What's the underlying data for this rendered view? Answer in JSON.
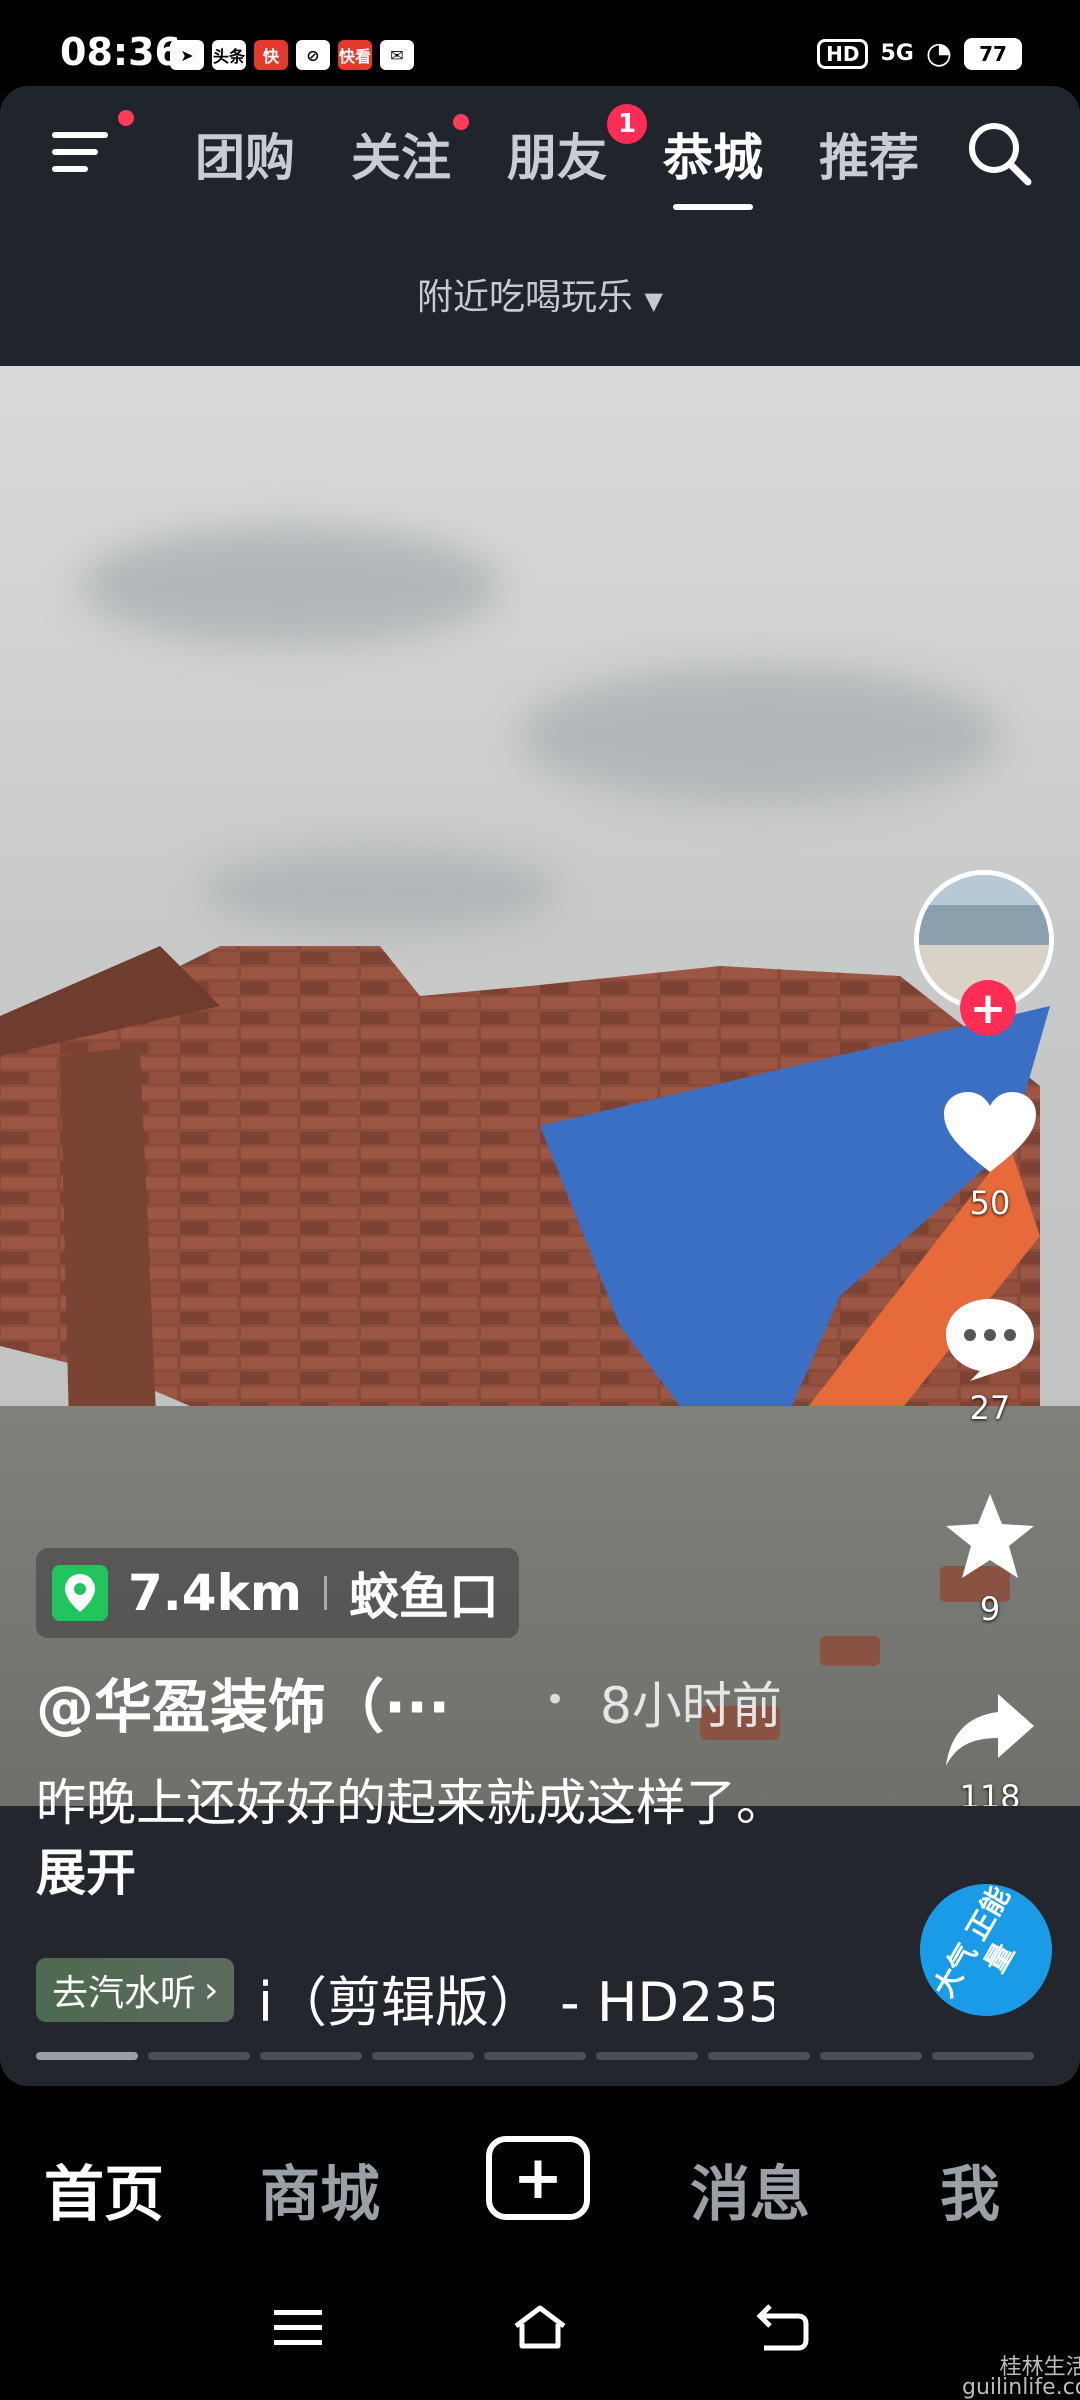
{
  "status": {
    "time": "08:36",
    "icons_left": [
      "头条",
      "快",
      "快看"
    ],
    "hd": "HD",
    "network": "5G",
    "battery": "77"
  },
  "tabs": [
    {
      "label": "团购",
      "dot": false
    },
    {
      "label": "关注",
      "dot": true
    },
    {
      "label": "朋友",
      "badge": "1"
    },
    {
      "label": "恭城",
      "active": true
    },
    {
      "label": "推荐"
    }
  ],
  "nearby_label": "附近吃喝玩乐",
  "location": {
    "distance": "7.4km",
    "place": "蛟鱼口"
  },
  "author": "@华盈装饰（···",
  "time_ago": "8小时前",
  "caption": {
    "text": "昨晚上还好好的起来就成这样了。",
    "expand": "展开"
  },
  "music": {
    "chip": "去汽水听",
    "title": "i（剪辑版） - HD235"
  },
  "energy_badge": "大气 正能量",
  "actions": {
    "likes": "50",
    "comments": "27",
    "favorites": "9",
    "shares": "118"
  },
  "nav": {
    "home": "首页",
    "mall": "商城",
    "messages": "消息",
    "me": "我"
  },
  "watermark": "桂林生活网\nguilinlife.com",
  "colors": {
    "accent": "#ff2d55",
    "location_pin": "#21c45d",
    "energy": "#1a9be8"
  }
}
